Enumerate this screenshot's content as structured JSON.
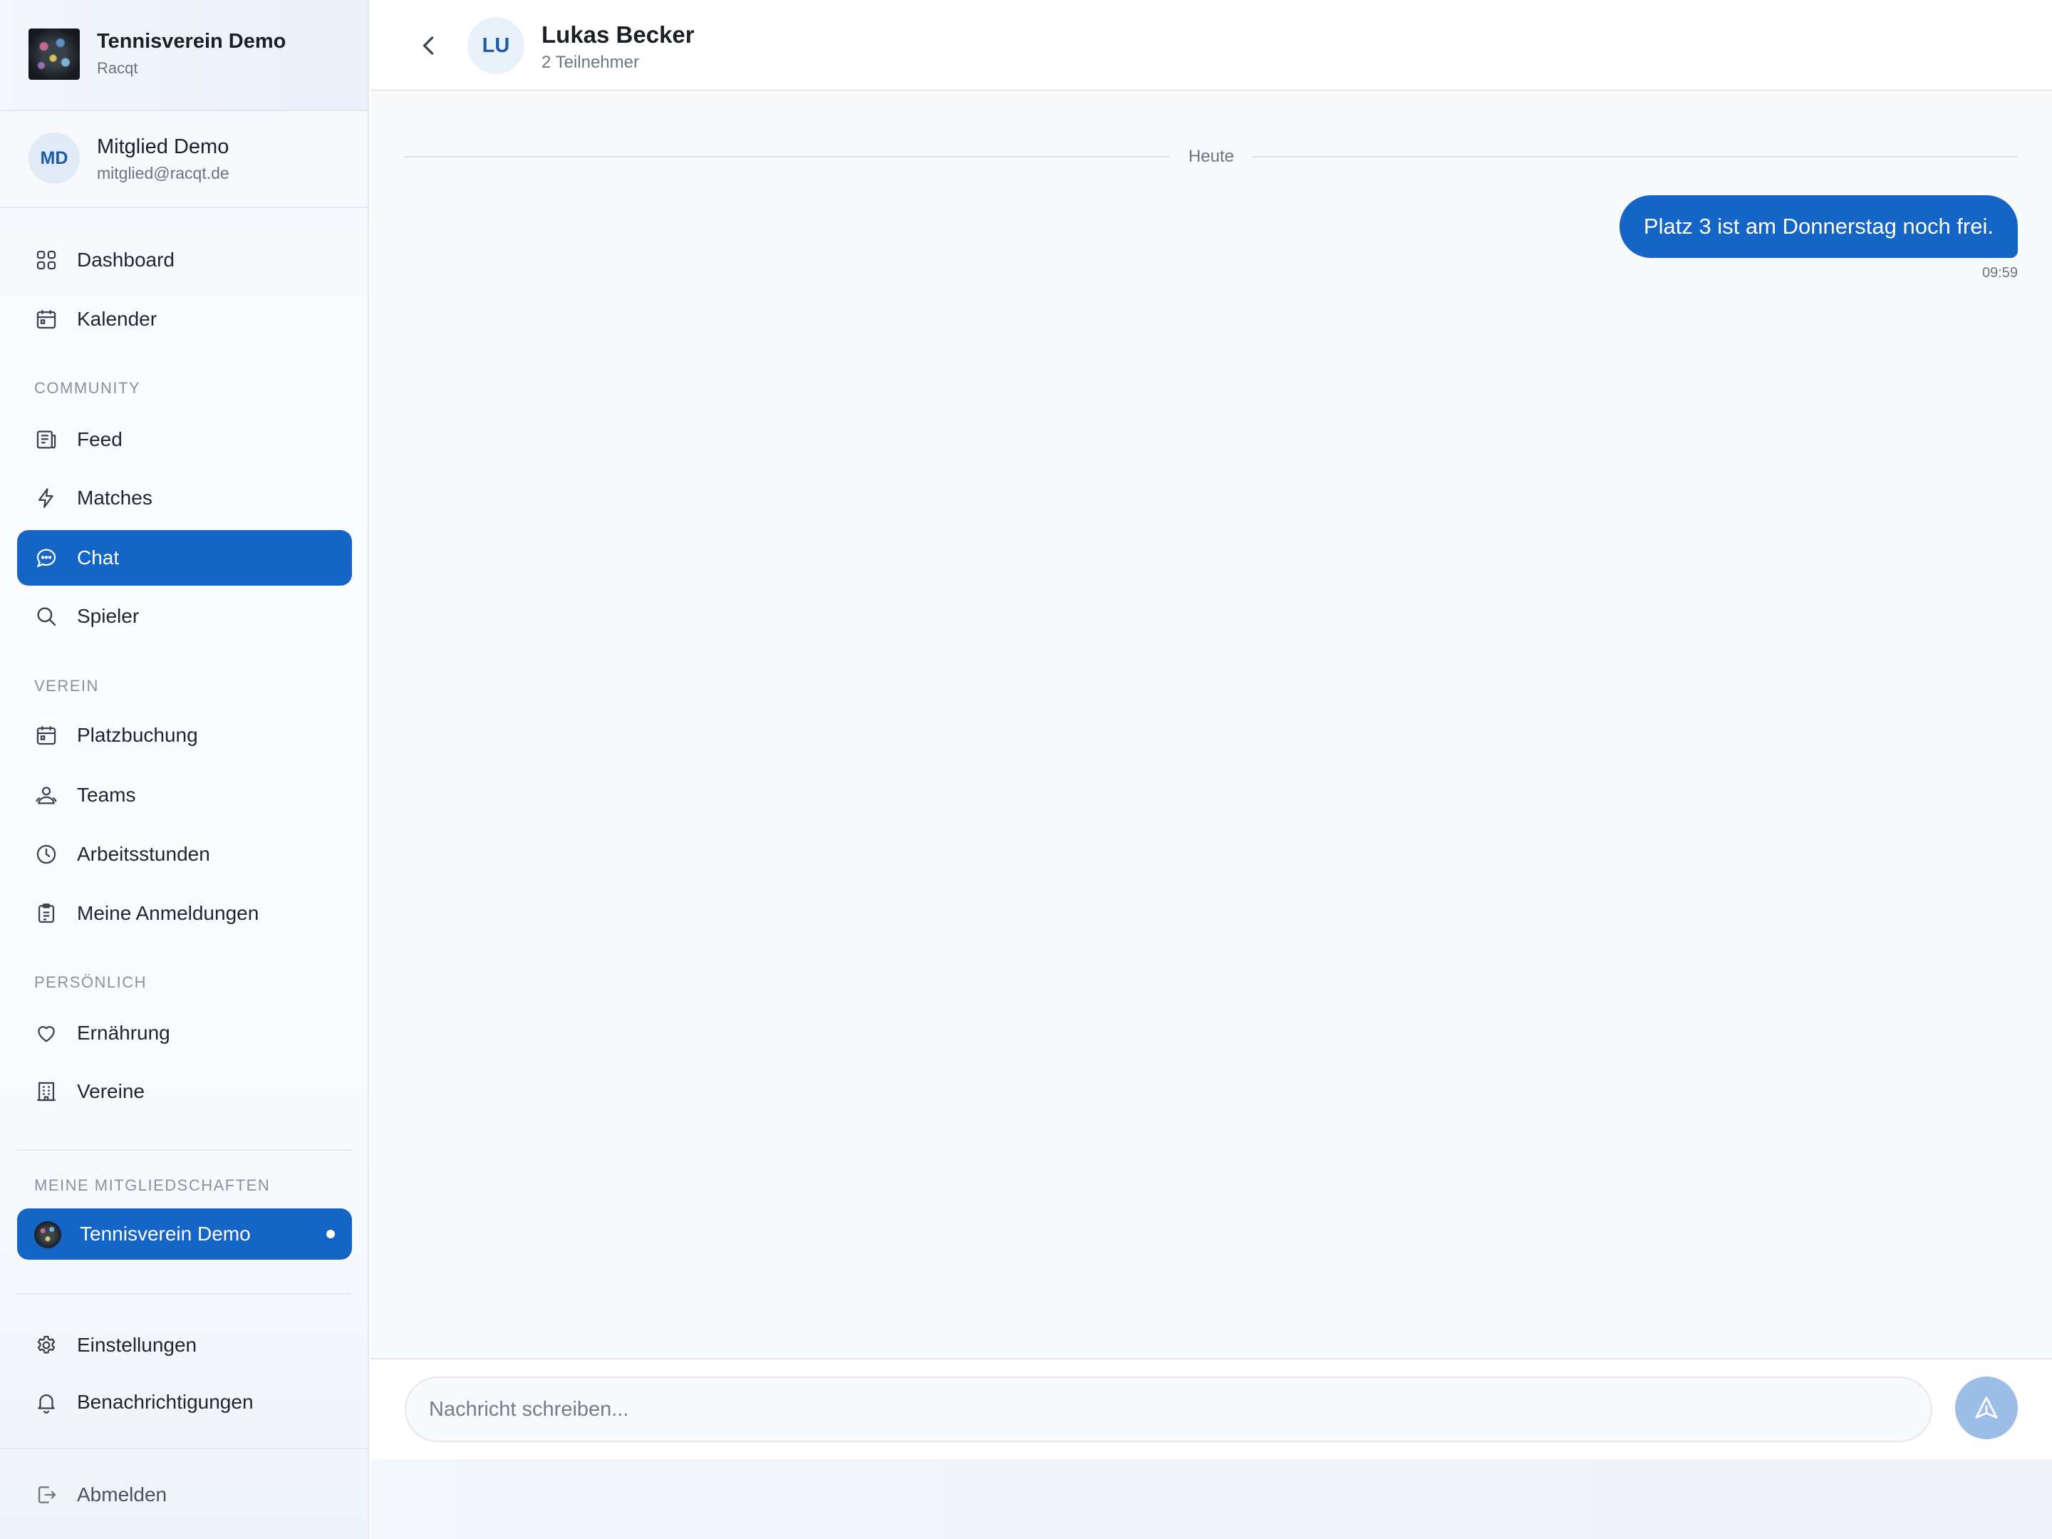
{
  "sidebar": {
    "club": {
      "name": "Tennisverein Demo",
      "subtitle": "Racqt"
    },
    "user": {
      "initials": "MD",
      "name": "Mitglied Demo",
      "email": "mitglied@racqt.de"
    },
    "items": {
      "dashboard": {
        "label": "Dashboard",
        "icon": "grid-icon"
      },
      "kalender": {
        "label": "Kalender",
        "icon": "calendar-icon"
      },
      "feed": {
        "label": "Feed",
        "icon": "newspaper-icon"
      },
      "matches": {
        "label": "Matches",
        "icon": "lightning-icon"
      },
      "chat": {
        "label": "Chat",
        "icon": "chat-bubble-icon",
        "active": true
      },
      "spieler": {
        "label": "Spieler",
        "icon": "search-icon"
      },
      "platzbuchung": {
        "label": "Platzbuchung",
        "icon": "calendar-icon"
      },
      "teams": {
        "label": "Teams",
        "icon": "users-icon"
      },
      "arbeitsstunden": {
        "label": "Arbeitsstunden",
        "icon": "clock-icon"
      },
      "anmeldungen": {
        "label": "Meine Anmeldungen",
        "icon": "clipboard-icon"
      },
      "ernaehrung": {
        "label": "Ernährung",
        "icon": "heart-icon"
      },
      "vereine": {
        "label": "Vereine",
        "icon": "building-icon"
      },
      "einstellungen": {
        "label": "Einstellungen",
        "icon": "gear-icon"
      },
      "benachrichtigungen": {
        "label": "Benachrichtigungen",
        "icon": "bell-icon"
      },
      "abmelden": {
        "label": "Abmelden",
        "icon": "logout-icon"
      }
    },
    "sections": {
      "community": "COMMUNITY",
      "verein": "VEREIN",
      "persoenlich": "PERSÖNLICH",
      "mitgliedschaften": "MEINE MITGLIEDSCHAFTEN"
    },
    "membership": {
      "label": "Tennisverein Demo"
    }
  },
  "chat": {
    "header": {
      "initials": "LU",
      "title": "Lukas Becker",
      "subtitle": "2 Teilnehmer"
    },
    "date_separator": "Heute",
    "messages": [
      {
        "text": "Platz 3 ist am Donnerstag noch frei.",
        "time": "09:59",
        "outgoing": true
      }
    ],
    "composer": {
      "placeholder": "Nachricht schreiben...",
      "value": ""
    }
  },
  "colors": {
    "accent": "#1565c6",
    "send_button": "#9cbde8",
    "avatar_bg": "#e1ebf8"
  }
}
